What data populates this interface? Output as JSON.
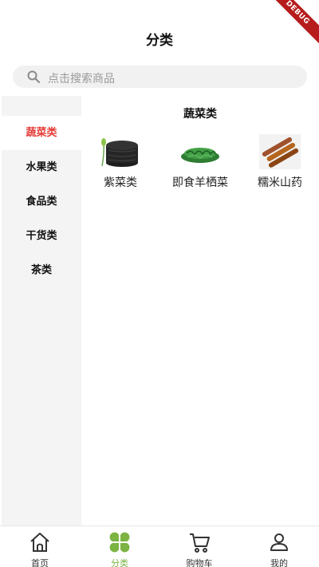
{
  "app": {
    "title": "分类",
    "debug_banner": "DEBUG"
  },
  "search": {
    "placeholder": "点击搜索商品",
    "icon": "search-icon"
  },
  "sidebar": {
    "items": [
      {
        "label": "蔬菜类",
        "active": true
      },
      {
        "label": "水果类",
        "active": false
      },
      {
        "label": "食品类",
        "active": false
      },
      {
        "label": "干货类",
        "active": false
      },
      {
        "label": "茶类",
        "active": false
      }
    ]
  },
  "content": {
    "category_title": "蔬菜类",
    "products": [
      {
        "name": "紫菜类"
      },
      {
        "name": "即食羊栖菜"
      },
      {
        "name": "糯米山药"
      }
    ]
  },
  "tabbar": {
    "items": [
      {
        "label": "首页",
        "icon": "home-icon",
        "active": false
      },
      {
        "label": "分类",
        "icon": "category-icon",
        "active": true
      },
      {
        "label": "购物车",
        "icon": "cart-icon",
        "active": false
      },
      {
        "label": "我的",
        "icon": "user-icon",
        "active": false
      }
    ]
  },
  "colors": {
    "active_sidebar_text": "#e53935",
    "active_tab": "#7cb342",
    "sidebar_bg": "#f4f4f4",
    "search_bg": "#f1f1f1"
  }
}
